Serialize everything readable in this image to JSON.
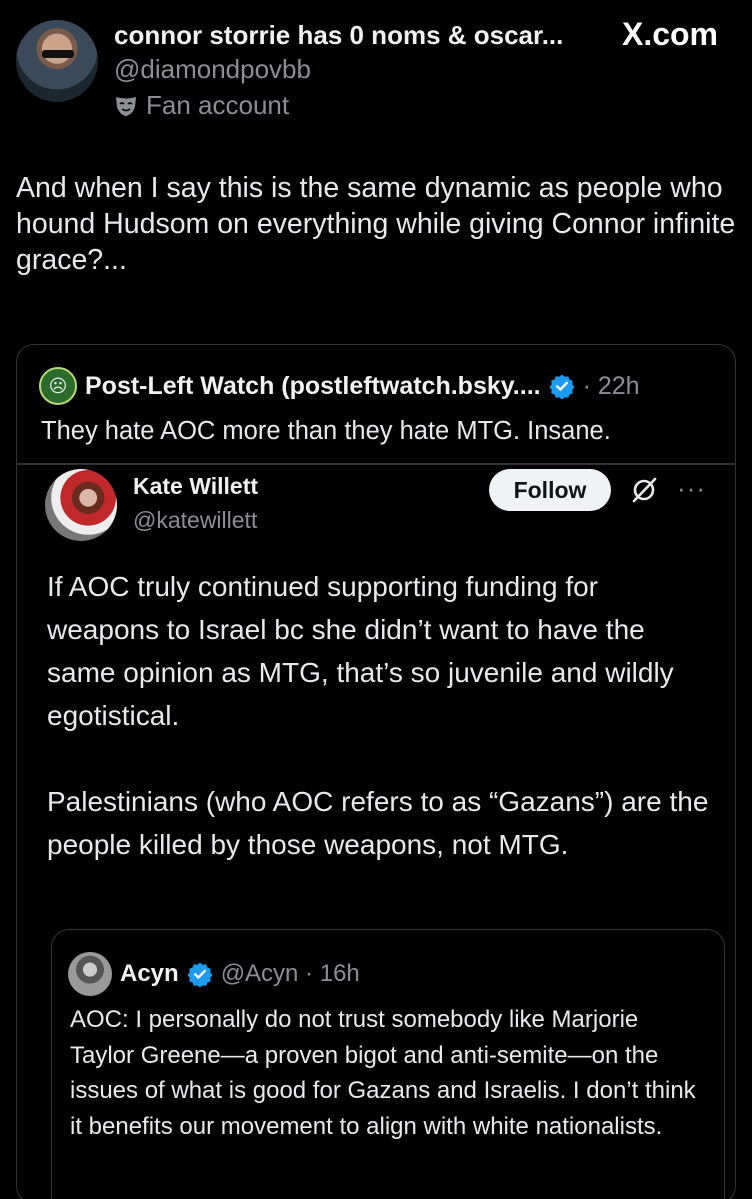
{
  "header": {
    "display_name": "connor storrie has 0 noms & oscar...",
    "handle": "@diamondpovbb",
    "badge_label": "Fan account",
    "site_label": "X.com"
  },
  "post": {
    "text": "And when I say this is the same dynamic as people who hound Hudsom on everything while giving Connor infinite grace?..."
  },
  "quote": {
    "name": "Post-Left Watch (postleftwatch.bsky....",
    "time": "· 22h",
    "text": "They hate AOC more than they hate MTG. Insane.",
    "nested": {
      "name": "Kate Willett",
      "handle": "@katewillett",
      "follow_label": "Follow",
      "more_label": "···",
      "paragraph1": "If AOC truly continued supporting funding for weapons to Israel bc she didn’t want to have the same opinion as MTG, that’s so juvenile and wildly egotistical.",
      "paragraph2": "Palestinians (who AOC refers to as “Gazans”) are the people killed by those weapons, not MTG.",
      "inner_quote": {
        "name": "Acyn",
        "handle_time": "@Acyn · 16h",
        "text": "AOC: I personally do not trust somebody like Marjorie Taylor Greene—a proven bigot and anti-semite—on the issues of  what is good for Gazans and Israelis. I don’t think it benefits our movement to align with white nationalists."
      }
    }
  },
  "colors": {
    "background": "#000000",
    "text": "#e7e9ea",
    "muted": "#8b8f94",
    "border": "#2f3336",
    "verified": "#1d9bf0"
  }
}
